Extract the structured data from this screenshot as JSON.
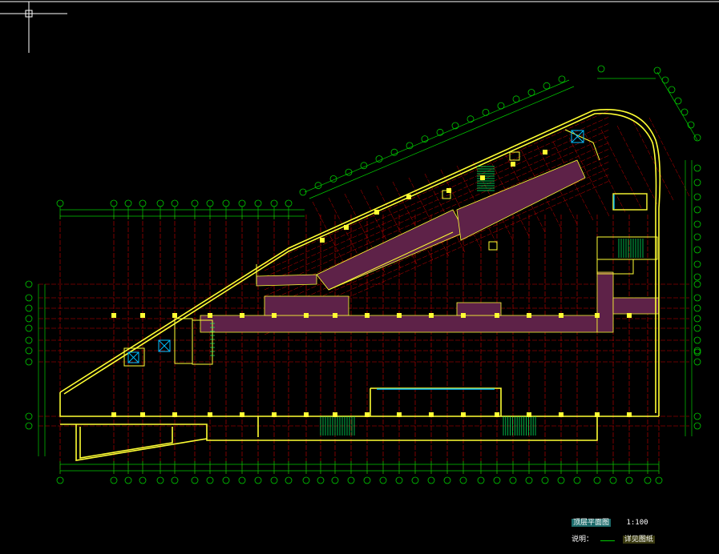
{
  "colors": {
    "background": "#000000",
    "wall": "#ffff33",
    "grid": "#cc0000",
    "dimension": "#00cc00",
    "corridor": "#5e2248",
    "water": "#00bfff",
    "stair": "#00ff66",
    "text": "#ffffff"
  },
  "icons": {
    "crosshair": "crosshair-cursor-icon",
    "elevator": "elevator-cross-icon"
  },
  "caption": {
    "title": "顶层平面图",
    "scale": "1:100",
    "note_prefix": "说明：",
    "note_text": "详见图纸"
  }
}
